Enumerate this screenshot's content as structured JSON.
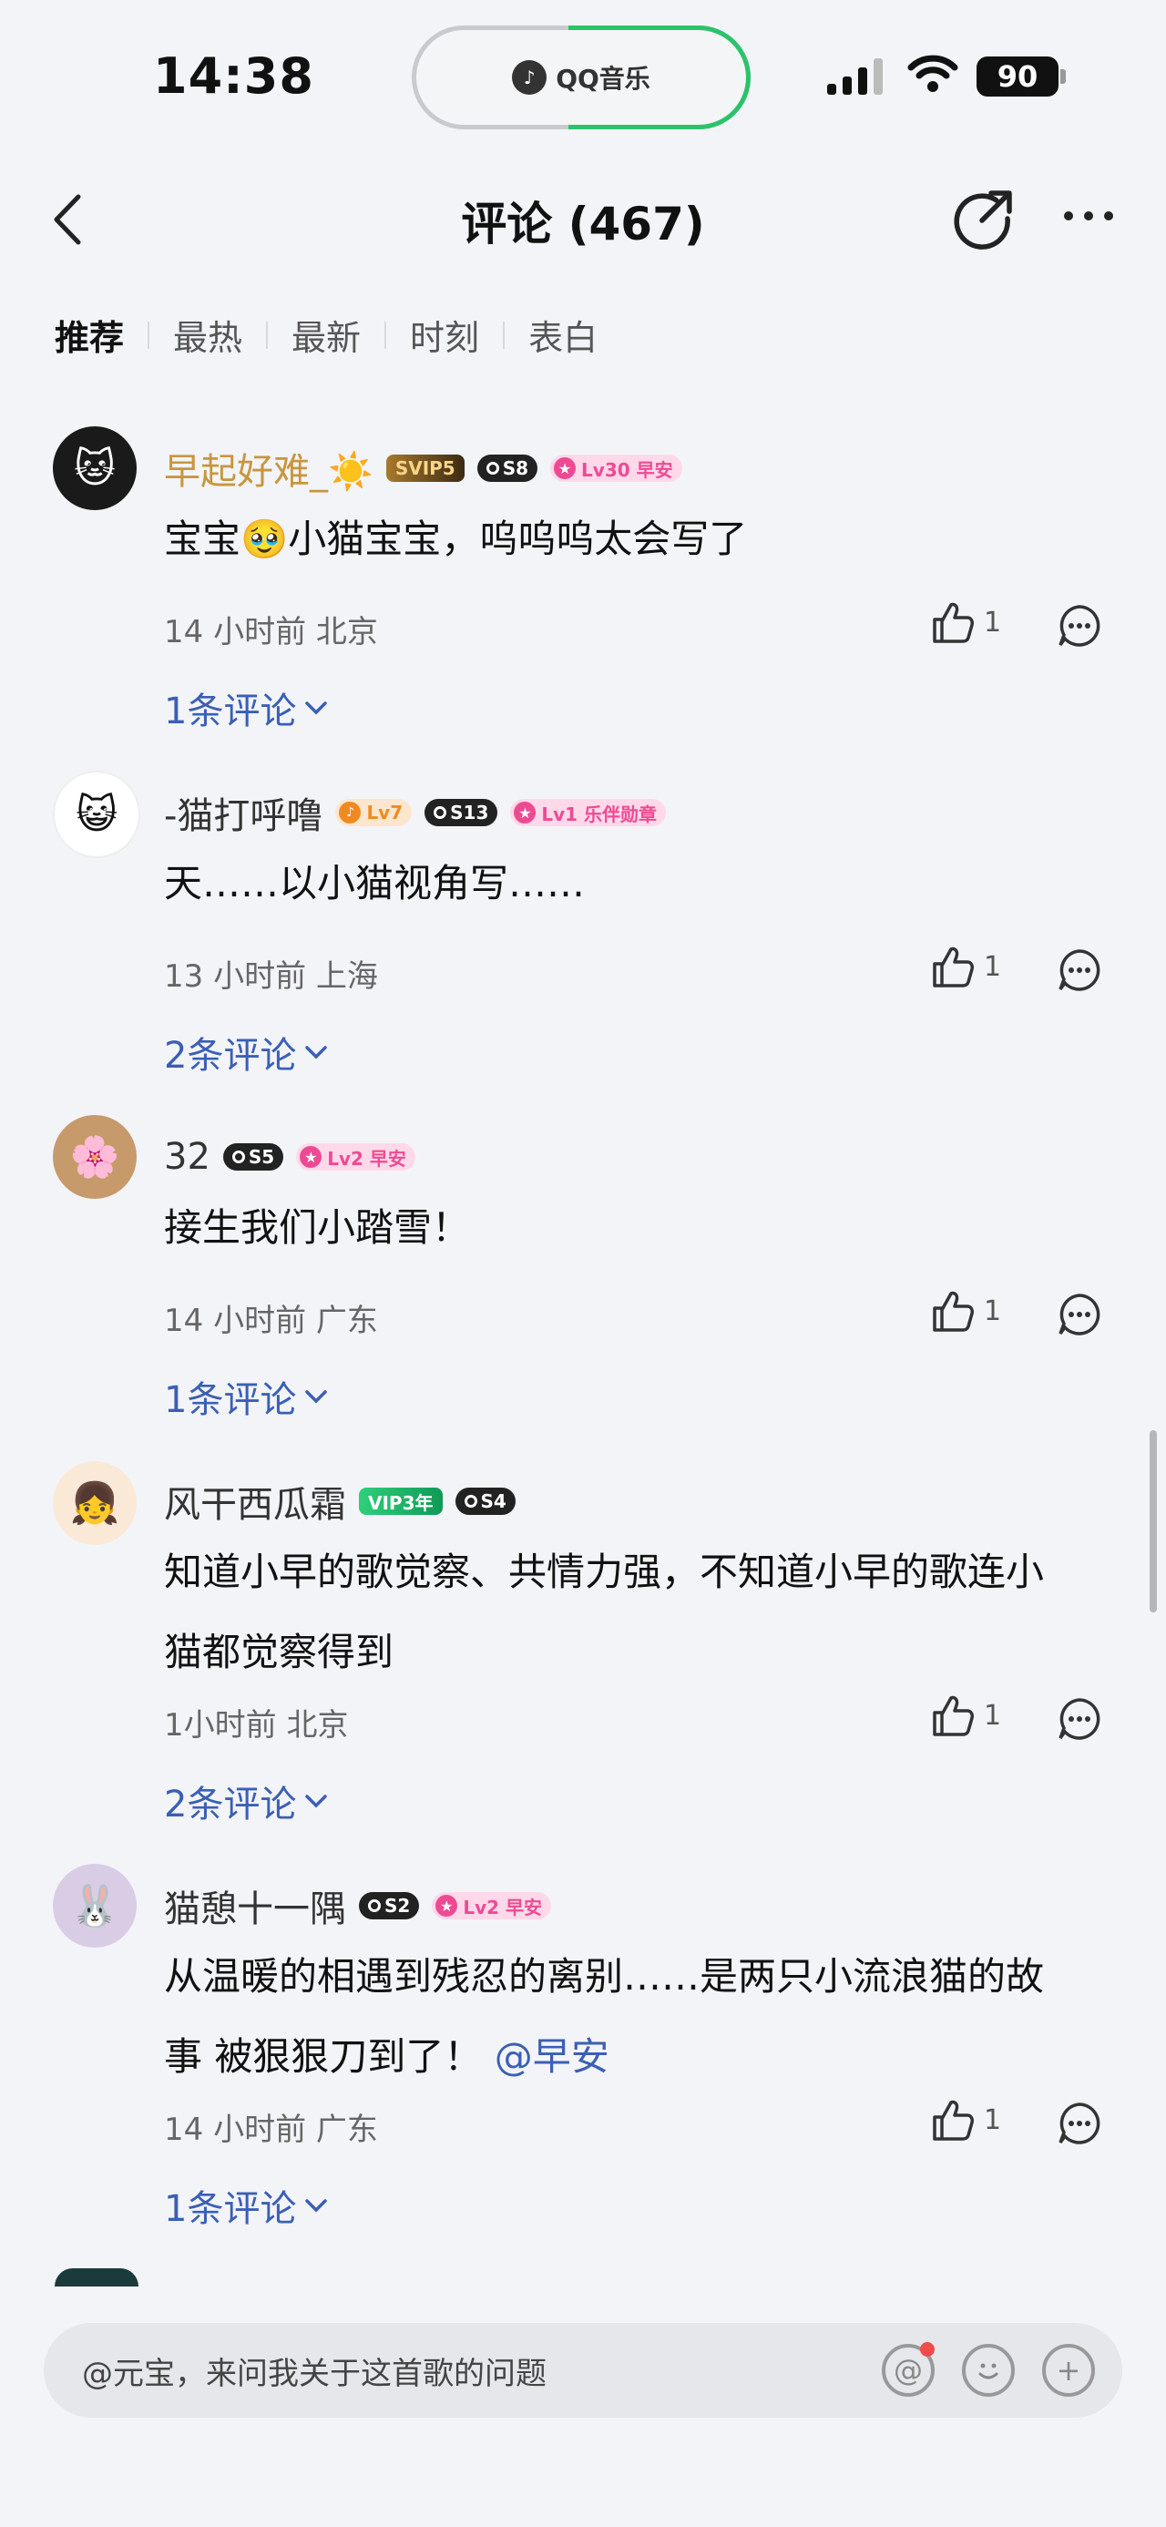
{
  "status": {
    "time": "14:38",
    "island_app": "QQ音乐",
    "battery": "90"
  },
  "header": {
    "title": "评论 (467)"
  },
  "tabs": [
    "推荐",
    "最热",
    "最新",
    "时刻",
    "表白"
  ],
  "comments": [
    {
      "username": "早起好难_☀️",
      "badges": {
        "vip": "SVIP5",
        "s": "S8",
        "lv": "Lv30 早安"
      },
      "text": "宝宝🥹小猫宝宝，呜呜呜太会写了",
      "meta": "14 小时前 北京",
      "likes": "1",
      "replies": "1条评论"
    },
    {
      "username": "-猫打呼噜",
      "badges": {
        "lvo": "Lv7",
        "s": "S13",
        "lv": "Lv1 乐伴勋章"
      },
      "text": "天……以小猫视角写……",
      "meta": "13 小时前 上海",
      "likes": "1",
      "replies": "2条评论"
    },
    {
      "username": "32",
      "badges": {
        "s": "S5",
        "lv": "Lv2 早安"
      },
      "text": "接生我们小踏雪！",
      "meta": "14 小时前 广东",
      "likes": "1",
      "replies": "1条评论"
    },
    {
      "username": "风干西瓜霜",
      "badges": {
        "vip": "VIP3年",
        "s": "S4"
      },
      "text_line1": "知道小早的歌觉察、共情力强，不知道小早的歌连小",
      "text_line2": "猫都觉察得到",
      "meta": "1小时前 北京",
      "likes": "1",
      "replies": "2条评论"
    },
    {
      "username": "猫憩十一隅",
      "badges": {
        "s": "S2",
        "lv": "Lv2 早安"
      },
      "text_line1": "从温暖的相遇到残忍的离别……是两只小流浪猫的故",
      "text_line2": "事 被狠狠刀到了！",
      "mention": "@早安",
      "meta": "14 小时前 广东",
      "likes": "1",
      "replies": "1条评论"
    }
  ],
  "input": {
    "placeholder": "@元宝，来问我关于这首歌的问题"
  }
}
